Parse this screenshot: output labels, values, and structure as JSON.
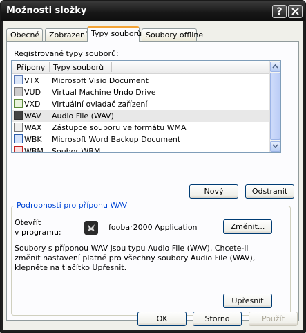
{
  "window": {
    "title": "Možnosti složky",
    "help_label": "?",
    "close_label": "X"
  },
  "tabs": [
    {
      "label": "Obecné"
    },
    {
      "label": "Zobrazení"
    },
    {
      "label": "Typy souborů"
    },
    {
      "label": "Soubory offline"
    }
  ],
  "registered": {
    "label": "Registrované typy souborů:",
    "columns": [
      "Přípony",
      "Typy souborů"
    ],
    "rows": [
      {
        "ext": "VTX",
        "desc": "Microsoft Visio Document",
        "icon": "visio-icon",
        "selected": false
      },
      {
        "ext": "VUD",
        "desc": "Virtual Machine Undo Drive",
        "icon": "vm-icon",
        "selected": false
      },
      {
        "ext": "VXD",
        "desc": "Virtuální ovladač zařízení",
        "icon": "driver-icon",
        "selected": false
      },
      {
        "ext": "WAV",
        "desc": "Audio File (WAV)",
        "icon": "foobar-icon",
        "selected": true
      },
      {
        "ext": "WAX",
        "desc": "Zástupce souboru ve formátu WMA",
        "icon": "media-icon",
        "selected": false
      },
      {
        "ext": "WBK",
        "desc": "Microsoft Word Backup Document",
        "icon": "word-icon",
        "selected": false
      },
      {
        "ext": "WBM",
        "desc": "Soubor WBM",
        "icon": "file-icon",
        "selected": false
      }
    ]
  },
  "buttons": {
    "new": "Nový",
    "delete": "Odstranit",
    "change": "Změnit...",
    "advanced": "Upřesnit",
    "ok": "OK",
    "cancel": "Storno",
    "apply": "Použít"
  },
  "details": {
    "title": "Podrobnosti pro příponu WAV",
    "opens_with_label_line1": "Otevřít",
    "opens_with_label_line2": "v programu:",
    "app_name": "foobar2000 Application",
    "description": "Soubory s příponou WAV jsou typu Audio File (WAV). Chcete-li změnit nastavení platné pro všechny soubory Audio File (WAV), klepněte na tlačítko Upřesnit."
  }
}
